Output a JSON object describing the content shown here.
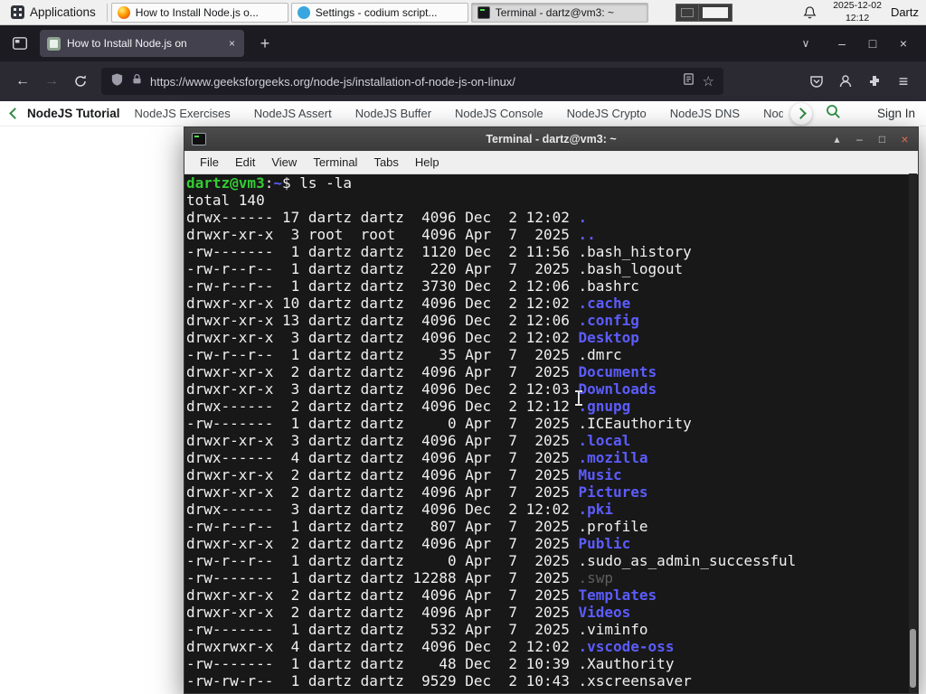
{
  "colors": {
    "accent-green": "#2f8d46",
    "term-bg": "#181818",
    "term-fg": "#f0f0f0",
    "term-green": "#33cc33",
    "term-blue": "#5c5cff",
    "term-dim": "#5e5e5e"
  },
  "icons": {
    "close": "×",
    "plus": "+",
    "minimize": "–",
    "maximize": "□",
    "shade": "▴",
    "tabs_chevron": "∨",
    "back": "←",
    "forward": "→",
    "menu": "≡",
    "star": "☆"
  },
  "panel": {
    "applications": "Applications",
    "taskbar": [
      {
        "app": "firefox",
        "title": "How to Install Node.js o...",
        "active": false
      },
      {
        "app": "codium",
        "title": "Settings - codium script...",
        "active": false
      },
      {
        "app": "terminal",
        "title": "Terminal - dartz@vm3: ~",
        "active": true
      }
    ],
    "date": "2025-12-02",
    "time": "12:12",
    "user": "Dartz"
  },
  "browser": {
    "tab": {
      "title": "How to Install Node.js on"
    },
    "url": "https://www.geeksforgeeks.org/node-js/installation-of-node-js-on-linux/",
    "site_nav": {
      "back_label": "NodeJS Tutorial",
      "links": [
        "NodeJS Exercises",
        "NodeJS Assert",
        "NodeJS Buffer",
        "NodeJS Console",
        "NodeJS Crypto",
        "NodeJS DNS",
        "Node"
      ],
      "sign_in": "Sign In"
    }
  },
  "terminal": {
    "title": "Terminal - dartz@vm3: ~",
    "menu": [
      "File",
      "Edit",
      "View",
      "Terminal",
      "Tabs",
      "Help"
    ],
    "prompt_segments": [
      {
        "text": "dartz@vm3",
        "color": "green"
      },
      {
        "text": ":",
        "color": "fg"
      },
      {
        "text": "~",
        "color": "blue"
      },
      {
        "text": "$ ",
        "color": "fg"
      },
      {
        "text": "ls -la",
        "color": "fg"
      }
    ],
    "total_line": "total 140",
    "entries": [
      {
        "perms": "drwx------",
        "links": "17",
        "owner": "dartz",
        "group": "dartz",
        "size": "4096",
        "month": "Dec",
        "day": "2",
        "time": "12:02",
        "name": ".",
        "type": "dir"
      },
      {
        "perms": "drwxr-xr-x",
        "links": "3",
        "owner": "root",
        "group": "root",
        "size": "4096",
        "month": "Apr",
        "day": "7",
        "time": "2025",
        "name": "..",
        "type": "dir"
      },
      {
        "perms": "-rw-------",
        "links": "1",
        "owner": "dartz",
        "group": "dartz",
        "size": "1120",
        "month": "Dec",
        "day": "2",
        "time": "11:56",
        "name": ".bash_history",
        "type": "file"
      },
      {
        "perms": "-rw-r--r--",
        "links": "1",
        "owner": "dartz",
        "group": "dartz",
        "size": "220",
        "month": "Apr",
        "day": "7",
        "time": "2025",
        "name": ".bash_logout",
        "type": "file"
      },
      {
        "perms": "-rw-r--r--",
        "links": "1",
        "owner": "dartz",
        "group": "dartz",
        "size": "3730",
        "month": "Dec",
        "day": "2",
        "time": "12:06",
        "name": ".bashrc",
        "type": "file"
      },
      {
        "perms": "drwxr-xr-x",
        "links": "10",
        "owner": "dartz",
        "group": "dartz",
        "size": "4096",
        "month": "Dec",
        "day": "2",
        "time": "12:02",
        "name": ".cache",
        "type": "dir"
      },
      {
        "perms": "drwxr-xr-x",
        "links": "13",
        "owner": "dartz",
        "group": "dartz",
        "size": "4096",
        "month": "Dec",
        "day": "2",
        "time": "12:06",
        "name": ".config",
        "type": "dir"
      },
      {
        "perms": "drwxr-xr-x",
        "links": "3",
        "owner": "dartz",
        "group": "dartz",
        "size": "4096",
        "month": "Dec",
        "day": "2",
        "time": "12:02",
        "name": "Desktop",
        "type": "dir"
      },
      {
        "perms": "-rw-r--r--",
        "links": "1",
        "owner": "dartz",
        "group": "dartz",
        "size": "35",
        "month": "Apr",
        "day": "7",
        "time": "2025",
        "name": ".dmrc",
        "type": "file"
      },
      {
        "perms": "drwxr-xr-x",
        "links": "2",
        "owner": "dartz",
        "group": "dartz",
        "size": "4096",
        "month": "Apr",
        "day": "7",
        "time": "2025",
        "name": "Documents",
        "type": "dir"
      },
      {
        "perms": "drwxr-xr-x",
        "links": "3",
        "owner": "dartz",
        "group": "dartz",
        "size": "4096",
        "month": "Dec",
        "day": "2",
        "time": "12:03",
        "name": "Downloads",
        "type": "dir"
      },
      {
        "perms": "drwx------",
        "links": "2",
        "owner": "dartz",
        "group": "dartz",
        "size": "4096",
        "month": "Dec",
        "day": "2",
        "time": "12:12",
        "name": ".gnupg",
        "type": "dir"
      },
      {
        "perms": "-rw-------",
        "links": "1",
        "owner": "dartz",
        "group": "dartz",
        "size": "0",
        "month": "Apr",
        "day": "7",
        "time": "2025",
        "name": ".ICEauthority",
        "type": "file"
      },
      {
        "perms": "drwxr-xr-x",
        "links": "3",
        "owner": "dartz",
        "group": "dartz",
        "size": "4096",
        "month": "Apr",
        "day": "7",
        "time": "2025",
        "name": ".local",
        "type": "dir"
      },
      {
        "perms": "drwx------",
        "links": "4",
        "owner": "dartz",
        "group": "dartz",
        "size": "4096",
        "month": "Apr",
        "day": "7",
        "time": "2025",
        "name": ".mozilla",
        "type": "dir"
      },
      {
        "perms": "drwxr-xr-x",
        "links": "2",
        "owner": "dartz",
        "group": "dartz",
        "size": "4096",
        "month": "Apr",
        "day": "7",
        "time": "2025",
        "name": "Music",
        "type": "dir"
      },
      {
        "perms": "drwxr-xr-x",
        "links": "2",
        "owner": "dartz",
        "group": "dartz",
        "size": "4096",
        "month": "Apr",
        "day": "7",
        "time": "2025",
        "name": "Pictures",
        "type": "dir"
      },
      {
        "perms": "drwx------",
        "links": "3",
        "owner": "dartz",
        "group": "dartz",
        "size": "4096",
        "month": "Dec",
        "day": "2",
        "time": "12:02",
        "name": ".pki",
        "type": "dir"
      },
      {
        "perms": "-rw-r--r--",
        "links": "1",
        "owner": "dartz",
        "group": "dartz",
        "size": "807",
        "month": "Apr",
        "day": "7",
        "time": "2025",
        "name": ".profile",
        "type": "file"
      },
      {
        "perms": "drwxr-xr-x",
        "links": "2",
        "owner": "dartz",
        "group": "dartz",
        "size": "4096",
        "month": "Apr",
        "day": "7",
        "time": "2025",
        "name": "Public",
        "type": "dir"
      },
      {
        "perms": "-rw-r--r--",
        "links": "1",
        "owner": "dartz",
        "group": "dartz",
        "size": "0",
        "month": "Apr",
        "day": "7",
        "time": "2025",
        "name": ".sudo_as_admin_successful",
        "type": "file"
      },
      {
        "perms": "-rw-------",
        "links": "1",
        "owner": "dartz",
        "group": "dartz",
        "size": "12288",
        "month": "Apr",
        "day": "7",
        "time": "2025",
        "name": ".swp",
        "type": "dim"
      },
      {
        "perms": "drwxr-xr-x",
        "links": "2",
        "owner": "dartz",
        "group": "dartz",
        "size": "4096",
        "month": "Apr",
        "day": "7",
        "time": "2025",
        "name": "Templates",
        "type": "dir"
      },
      {
        "perms": "drwxr-xr-x",
        "links": "2",
        "owner": "dartz",
        "group": "dartz",
        "size": "4096",
        "month": "Apr",
        "day": "7",
        "time": "2025",
        "name": "Videos",
        "type": "dir"
      },
      {
        "perms": "-rw-------",
        "links": "1",
        "owner": "dartz",
        "group": "dartz",
        "size": "532",
        "month": "Apr",
        "day": "7",
        "time": "2025",
        "name": ".viminfo",
        "type": "file"
      },
      {
        "perms": "drwxrwxr-x",
        "links": "4",
        "owner": "dartz",
        "group": "dartz",
        "size": "4096",
        "month": "Dec",
        "day": "2",
        "time": "12:02",
        "name": ".vscode-oss",
        "type": "dir"
      },
      {
        "perms": "-rw-------",
        "links": "1",
        "owner": "dartz",
        "group": "dartz",
        "size": "48",
        "month": "Dec",
        "day": "2",
        "time": "10:39",
        "name": ".Xauthority",
        "type": "file"
      },
      {
        "perms": "-rw-rw-r--",
        "links": "1",
        "owner": "dartz",
        "group": "dartz",
        "size": "9529",
        "month": "Dec",
        "day": "2",
        "time": "10:43",
        "name": ".xscreensaver",
        "type": "file"
      }
    ]
  }
}
